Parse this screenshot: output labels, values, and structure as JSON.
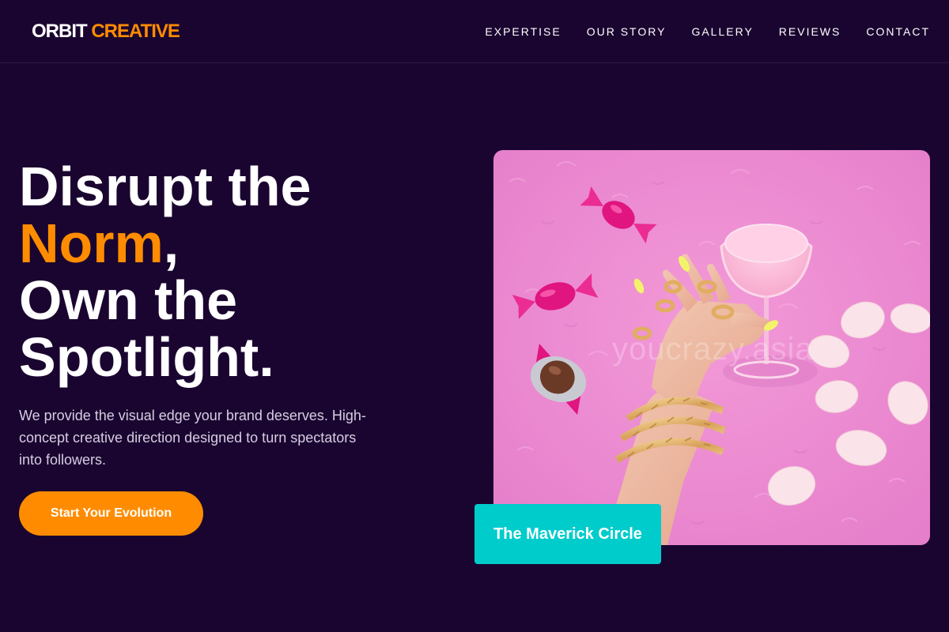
{
  "brand": {
    "name_part1": "ORBIT",
    "name_part2": "CREATIVE",
    "accent_color": "#ff8c00"
  },
  "nav": {
    "items": [
      {
        "label": "EXPERTISE"
      },
      {
        "label": "OUR STORY"
      },
      {
        "label": "GALLERY"
      },
      {
        "label": "REVIEWS"
      },
      {
        "label": "CONTACT"
      }
    ]
  },
  "hero": {
    "headline_line1": "Disrupt the",
    "headline_accent": "Norm",
    "headline_comma": ",",
    "headline_line3": "Own the",
    "headline_line4": "Spotlight.",
    "subtitle": "We provide the visual edge your brand deserves. High-concept creative direction designed to turn spectators into followers.",
    "cta_label": "Start Your Evolution"
  },
  "image": {
    "watermark": "youcrazy.asia",
    "card_label": "The Maverick Circle",
    "card_color": "#00cccc"
  },
  "colors": {
    "background": "#1a0530",
    "accent": "#ff8c00",
    "teal": "#00cccc"
  }
}
